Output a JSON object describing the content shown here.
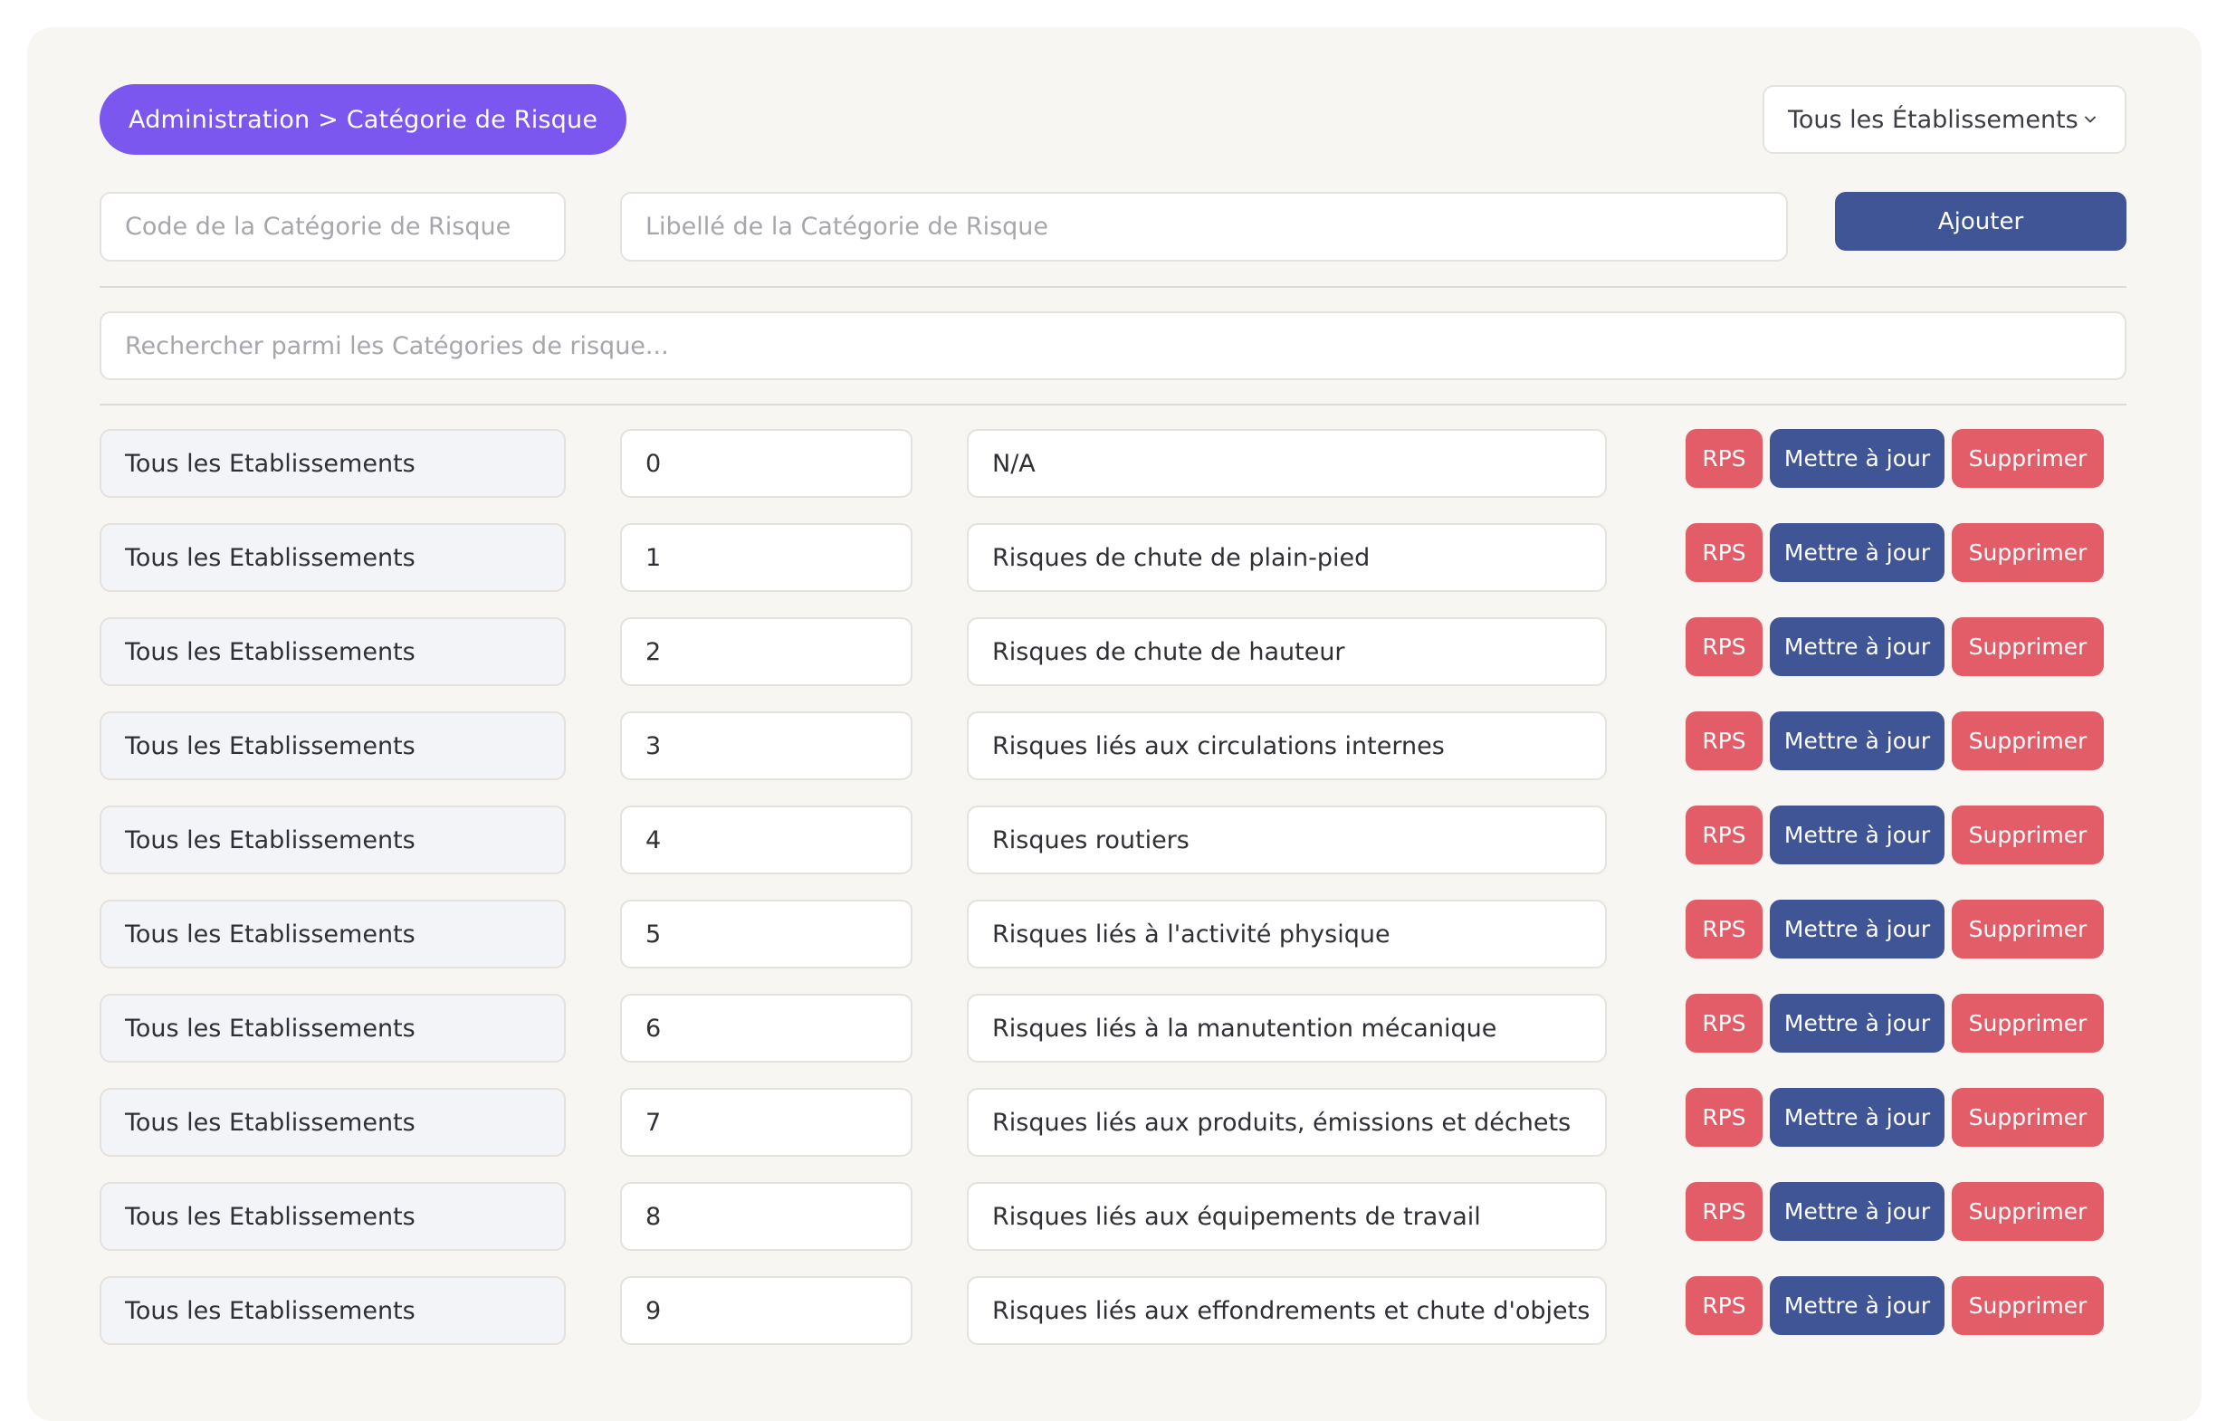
{
  "header": {
    "breadcrumb": "Administration > Catégorie de Risque",
    "establishment_filter": "Tous les Établissements"
  },
  "form": {
    "code_placeholder": "Code de la Catégorie de Risque",
    "label_placeholder": "Libellé de la Catégorie de Risque",
    "add_label": "Ajouter"
  },
  "search": {
    "placeholder": "Rechercher parmi les Catégories de risque..."
  },
  "actions": {
    "rps_label": "RPS",
    "update_label": "Mettre à jour",
    "delete_label": "Supprimer"
  },
  "rows": [
    {
      "establishment": "Tous les Etablissements",
      "code": "0",
      "label": "N/A"
    },
    {
      "establishment": "Tous les Etablissements",
      "code": "1",
      "label": "Risques de chute de plain-pied"
    },
    {
      "establishment": "Tous les Etablissements",
      "code": "2",
      "label": "Risques de chute de hauteur"
    },
    {
      "establishment": "Tous les Etablissements",
      "code": "3",
      "label": "Risques liés aux circulations internes"
    },
    {
      "establishment": "Tous les Etablissements",
      "code": "4",
      "label": "Risques routiers"
    },
    {
      "establishment": "Tous les Etablissements",
      "code": "5",
      "label": "Risques liés à l'activité physique"
    },
    {
      "establishment": "Tous les Etablissements",
      "code": "6",
      "label": "Risques liés à la manutention mécanique"
    },
    {
      "establishment": "Tous les Etablissements",
      "code": "7",
      "label": "Risques liés aux produits, émissions et déchets"
    },
    {
      "establishment": "Tous les Etablissements",
      "code": "8",
      "label": "Risques liés aux équipements de travail"
    },
    {
      "establishment": "Tous les Etablissements",
      "code": "9",
      "label": "Risques liés aux effondrements et chute d'objets"
    }
  ],
  "colors": {
    "breadcrumb": "#7b57f0",
    "primary": "#3f5595",
    "danger": "#e35d68",
    "card_background": "#f8f6f2"
  },
  "icons": {
    "filter_dropdown": "chevron-down-icon"
  }
}
